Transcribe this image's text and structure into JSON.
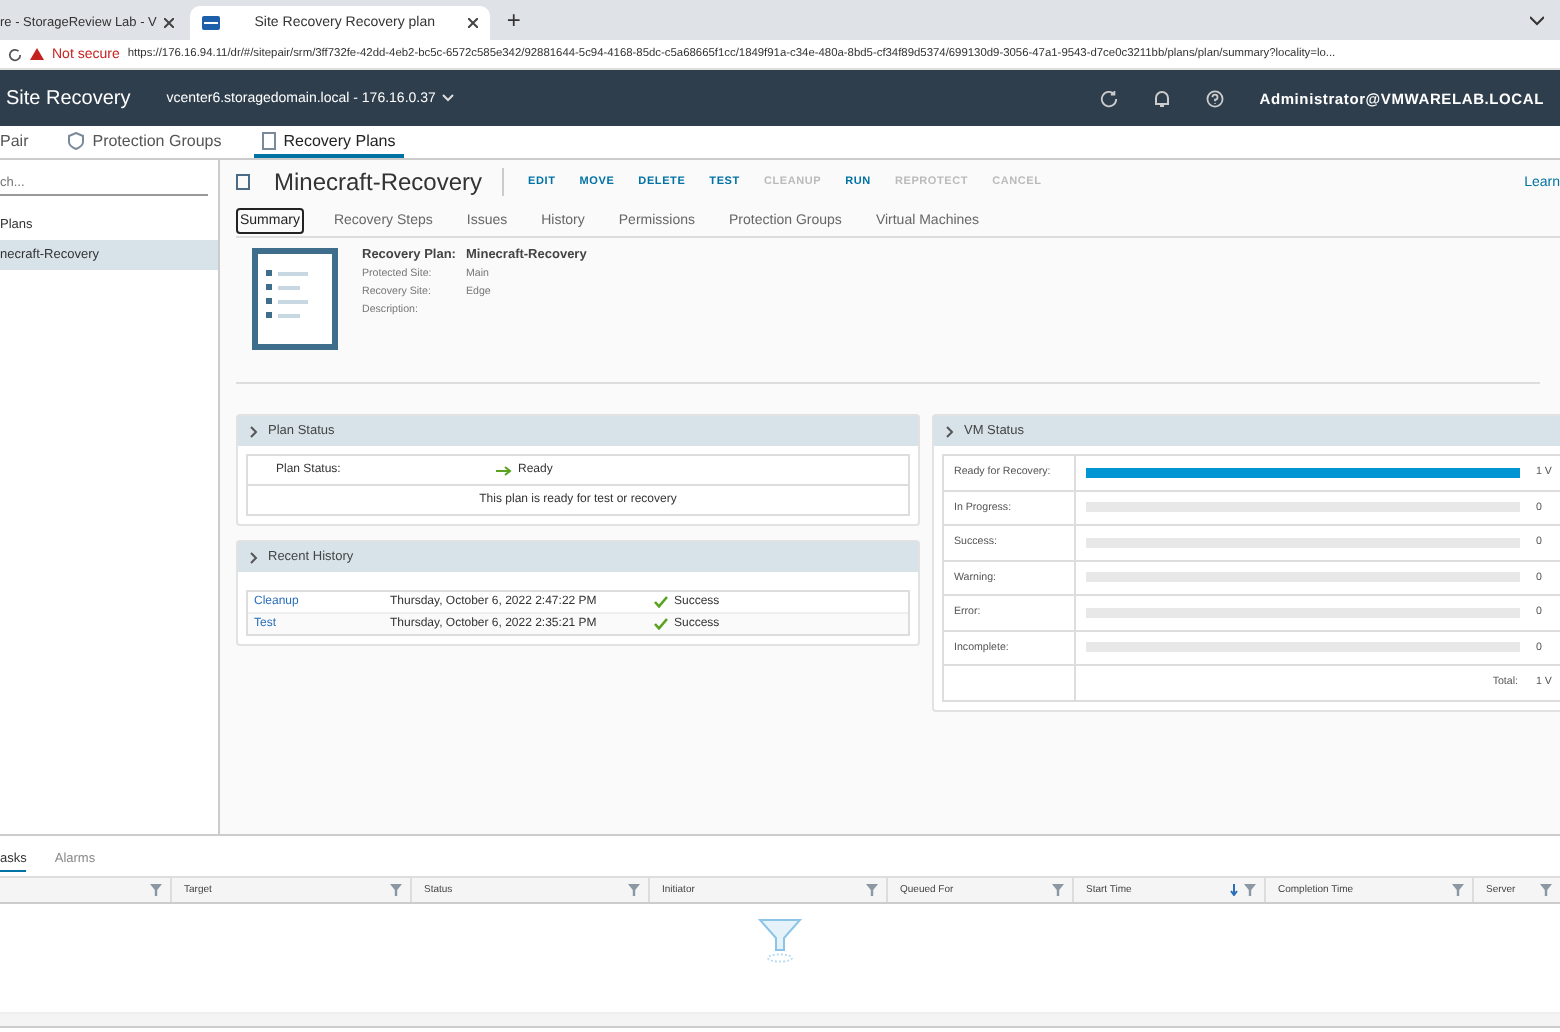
{
  "browser": {
    "tabs": [
      {
        "title": "re - StorageReview Lab - V",
        "selected": false
      },
      {
        "title": "Site Recovery Recovery plan",
        "selected": true
      }
    ],
    "new_tab": "+",
    "security": "Not secure",
    "url": "https://176.16.94.11/dr/#/sitepair/srm/3ff732fe-42dd-4eb2-bc5c-6572c585e342/92881644-5c94-4168-85dc-c5a68665f1cc/1849f91a-c34e-480a-8bd5-cf34f89d5374/699130d9-3056-47a1-9543-d7ce0c3211bb/plans/plan/summary?locality=lo..."
  },
  "app": {
    "title": "Site Recovery",
    "server": "vcenter6.storagedomain.local - 176.16.0.37",
    "user": "Administrator@VMWARELAB.LOCAL"
  },
  "nav_tabs": [
    {
      "label": "Pair",
      "selected": false
    },
    {
      "label": "Protection Groups",
      "selected": false
    },
    {
      "label": "Recovery Plans",
      "selected": true
    }
  ],
  "sidebar": {
    "placeholder": "ch...",
    "items": [
      {
        "label": "Plans",
        "selected": false
      },
      {
        "label": "necraft-Recovery",
        "selected": true
      }
    ]
  },
  "plan": {
    "name": "Minecraft-Recovery",
    "actions": [
      {
        "label": "EDIT",
        "disabled": false
      },
      {
        "label": "MOVE",
        "disabled": false
      },
      {
        "label": "DELETE",
        "disabled": false
      },
      {
        "label": "TEST",
        "disabled": false
      },
      {
        "label": "CLEANUP",
        "disabled": true
      },
      {
        "label": "RUN",
        "disabled": false
      },
      {
        "label": "REPROTECT",
        "disabled": true
      },
      {
        "label": "CANCEL",
        "disabled": true
      }
    ],
    "learn": "Learn",
    "tabs": [
      {
        "label": "Summary",
        "selected": true
      },
      {
        "label": "Recovery Steps",
        "selected": false
      },
      {
        "label": "Issues",
        "selected": false
      },
      {
        "label": "History",
        "selected": false
      },
      {
        "label": "Permissions",
        "selected": false
      },
      {
        "label": "Protection Groups",
        "selected": false
      },
      {
        "label": "Virtual Machines",
        "selected": false
      }
    ],
    "summary": [
      {
        "label": "Recovery Plan:",
        "value": "Minecraft-Recovery",
        "kind": "heading"
      },
      {
        "label": "Protected Site:",
        "value": "Main",
        "kind": "detail"
      },
      {
        "label": "Recovery Site:",
        "value": "Edge",
        "kind": "detail"
      },
      {
        "label": "Description:",
        "kind": "detail"
      }
    ]
  },
  "plan_status": {
    "title": "Plan Status",
    "label": "Plan Status:",
    "status": "Ready",
    "message": "This plan is ready for test or recovery"
  },
  "recent_history": {
    "title": "Recent History",
    "rows": [
      {
        "operation": "Cleanup",
        "time": "Thursday, October 6, 2022 2:47:22 PM",
        "result": "Success"
      },
      {
        "operation": "Test",
        "time": "Thursday, October 6, 2022 2:35:21 PM",
        "result": "Success"
      }
    ]
  },
  "vm_status": {
    "title": "VM Status",
    "rows": [
      {
        "label": "Ready for Recovery:",
        "level": 1,
        "count": "1 V"
      },
      {
        "label": "In Progress:",
        "level": 0,
        "count": "0"
      },
      {
        "label": "Success:",
        "level": 0,
        "count": "0"
      },
      {
        "label": "Warning:",
        "level": 0,
        "count": "0"
      },
      {
        "label": "Error:",
        "level": 0,
        "count": "0"
      },
      {
        "label": "Incomplete:",
        "level": 0,
        "count": "0"
      }
    ],
    "total_label": "Total:",
    "total": "1 V"
  },
  "bottom": {
    "tabs": [
      {
        "label": "asks",
        "selected": true
      },
      {
        "label": "Alarms",
        "selected": false
      }
    ],
    "columns": [
      {
        "label": "Target",
        "sorted": false
      },
      {
        "label": "Status",
        "sorted": false
      },
      {
        "label": "Initiator",
        "sorted": false
      },
      {
        "label": "Queued For",
        "sorted": false
      },
      {
        "label": "Start Time",
        "sorted": true
      },
      {
        "label": "Completion Time",
        "sorted": false
      },
      {
        "label": "Server",
        "sorted": false
      }
    ]
  }
}
